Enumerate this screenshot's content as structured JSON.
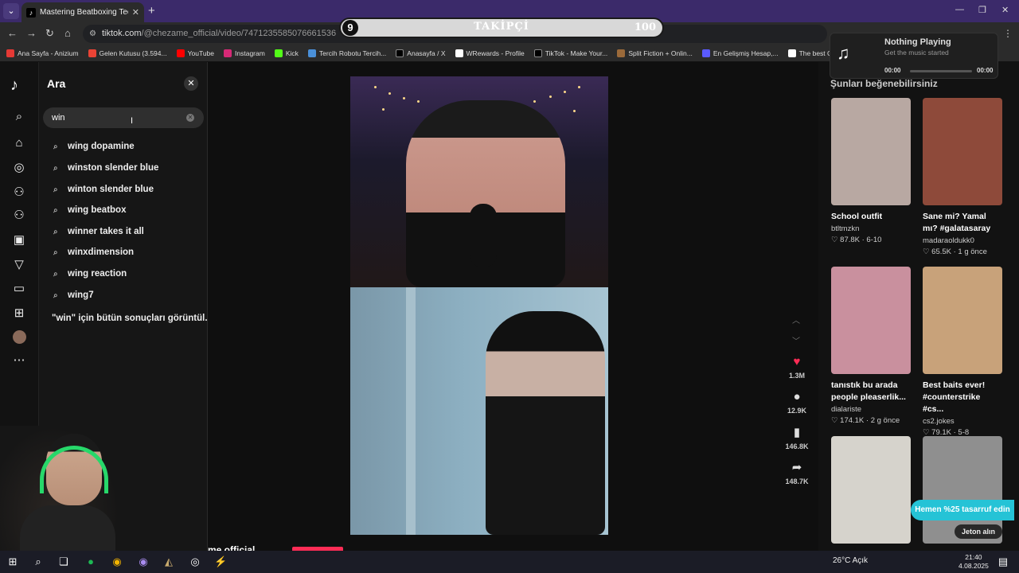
{
  "browser": {
    "tab_title": "Mastering Beatboxing Techniq...",
    "url_host": "tiktok.com",
    "url_path": "/@chezame_official/video/7471235585076661536",
    "bookmarks": [
      "Ana Sayfa - Anizium",
      "Gelen Kutusu (3.594...",
      "YouTube",
      "Instagram",
      "Kick",
      "Tercih Robotu Tercih...",
      "Anasayfa / X",
      "WRewards - Profile",
      "TikTok - Make Your...",
      "Split Fiction + Onlin...",
      "En Gelişmiş Hesap,...",
      "The best ChatBot an..."
    ]
  },
  "follower_overlay": {
    "count": "9",
    "label": "TAKİPÇİ",
    "goal": "100"
  },
  "search": {
    "title": "Ara",
    "query": "win",
    "suggestions": [
      "wing dopamine",
      "winston slender blue",
      "winton slender blue",
      "wing beatbox",
      "winner takes it all",
      "winxdimension",
      "wing reaction",
      "wing7"
    ],
    "all_results": "\"win\" için bütün sonuçları görüntül..."
  },
  "video": {
    "likes": "1.3M",
    "comments": "12.9K",
    "saves": "146.8K",
    "shares": "148.7K",
    "author_partial": "me official"
  },
  "right_column": {
    "title": "Şunları beğenebilirsiniz",
    "items": [
      {
        "caption": "School outfit",
        "user": "btltmzkn",
        "stats": "♡ 87.8K · 6-10",
        "color": "#b8a8a2"
      },
      {
        "caption": "Sane mi? Yamal mı? #galatasaray",
        "user": "madaraoldukk0",
        "stats": "♡ 65.5K · 1 g önce",
        "color": "#8e4a3a"
      },
      {
        "caption": "tanıstık bu arada people pleaserlik...",
        "user": "dialariste",
        "stats": "♡ 174.1K · 2 g önce",
        "color": "#c9909e"
      },
      {
        "caption": "Best baits ever! #counterstrike #cs...",
        "user": "cs2.jokes",
        "stats": "♡ 79.1K · 5-8",
        "color": "#c8a27a"
      },
      {
        "caption": "",
        "user": "",
        "stats": "",
        "color": "#d6d3cc"
      },
      {
        "caption": "",
        "user": "",
        "stats": "",
        "color": "#8f8f8f"
      }
    ]
  },
  "music": {
    "title": "Nothing Playing",
    "subtitle": "Get the music started",
    "time_start": "00:00",
    "time_end": "00:00"
  },
  "promo": {
    "label": "Hemen %25 tasarruf edin",
    "coin": "Jeton alın"
  },
  "taskbar": {
    "weather": "26°C  Açık",
    "time": "21:40",
    "date": "4.08.2025"
  }
}
